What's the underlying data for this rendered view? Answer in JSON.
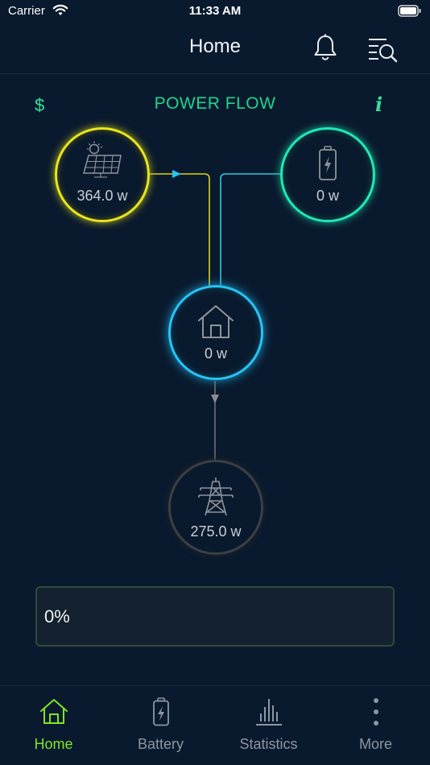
{
  "status_bar": {
    "carrier": "Carrier",
    "time": "11:33 AM"
  },
  "header": {
    "title": "Home",
    "icons": [
      "bell-icon",
      "search-list-icon"
    ]
  },
  "power_flow": {
    "title": "POWER FLOW",
    "currency_symbol": "$",
    "info_symbol": "i",
    "solar": {
      "icon": "solar-panel-icon",
      "value": "364.0 w",
      "color": "#e8e620"
    },
    "battery": {
      "icon": "battery-icon",
      "value": "0 w",
      "color": "#20e8b8"
    },
    "home": {
      "icon": "house-icon",
      "value": "0 w",
      "color": "#28c4f5"
    },
    "grid": {
      "icon": "power-tower-icon",
      "value": "275.0 w",
      "color": "#3c3f44"
    }
  },
  "progress": {
    "text": "0%"
  },
  "tabs": [
    {
      "label": "Home",
      "icon": "home-icon",
      "active": true
    },
    {
      "label": "Battery",
      "icon": "battery-icon",
      "active": false
    },
    {
      "label": "Statistics",
      "icon": "statistics-icon",
      "active": false
    },
    {
      "label": "More",
      "icon": "more-icon",
      "active": false
    }
  ],
  "colors": {
    "accent": "#1ed58d",
    "active_tab": "#7ee52b",
    "background": "#0a1a2e"
  }
}
